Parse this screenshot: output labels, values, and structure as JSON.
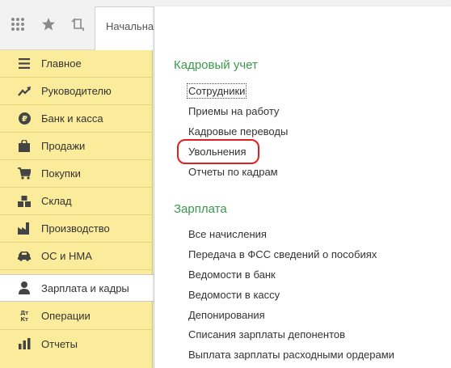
{
  "toolbar": {
    "icons": [
      "apps-grid-icon",
      "favorites-star-icon",
      "history-icon"
    ],
    "tab_label": "Начальна"
  },
  "sidebar": {
    "items": [
      {
        "label": "Главное",
        "icon": "menu-lines-icon"
      },
      {
        "label": "Руководителю",
        "icon": "trend-chart-icon"
      },
      {
        "label": "Банк и касса",
        "icon": "ruble-coin-icon"
      },
      {
        "label": "Продажи",
        "icon": "shopping-bag-icon"
      },
      {
        "label": "Покупки",
        "icon": "shopping-cart-icon"
      },
      {
        "label": "Склад",
        "icon": "warehouse-boxes-icon"
      },
      {
        "label": "Производство",
        "icon": "factory-icon"
      },
      {
        "label": "ОС и НМА",
        "icon": "assets-car-icon"
      },
      {
        "label": "Зарплата и кадры",
        "icon": "person-icon",
        "active": true
      },
      {
        "label": "Операции",
        "icon": "debit-credit-icon",
        "icon_text": "Дт Кт"
      },
      {
        "label": "Отчеты",
        "icon": "reports-chart-icon"
      }
    ]
  },
  "panel": {
    "sections": [
      {
        "title": "Кадровый учет",
        "links": [
          "Сотрудники",
          "Приемы на работу",
          "Кадровые переводы",
          "Увольнения",
          "Отчеты по кадрам"
        ]
      },
      {
        "title": "Зарплата",
        "links": [
          "Все начисления",
          "Передача в ФСС сведений о пособиях",
          "Ведомости в банк",
          "Ведомости в кассу",
          "Депонирования",
          "Списания зарплаты депонентов",
          "Выплата зарплаты расходными ордерами"
        ]
      }
    ],
    "highlighted_link": "Увольнения",
    "highlight_color": "#e02020"
  },
  "colors": {
    "sidebar_bg": "#fbec9c",
    "section_title": "#3a9a4a",
    "toolbar_bg": "#f2f2f2"
  }
}
